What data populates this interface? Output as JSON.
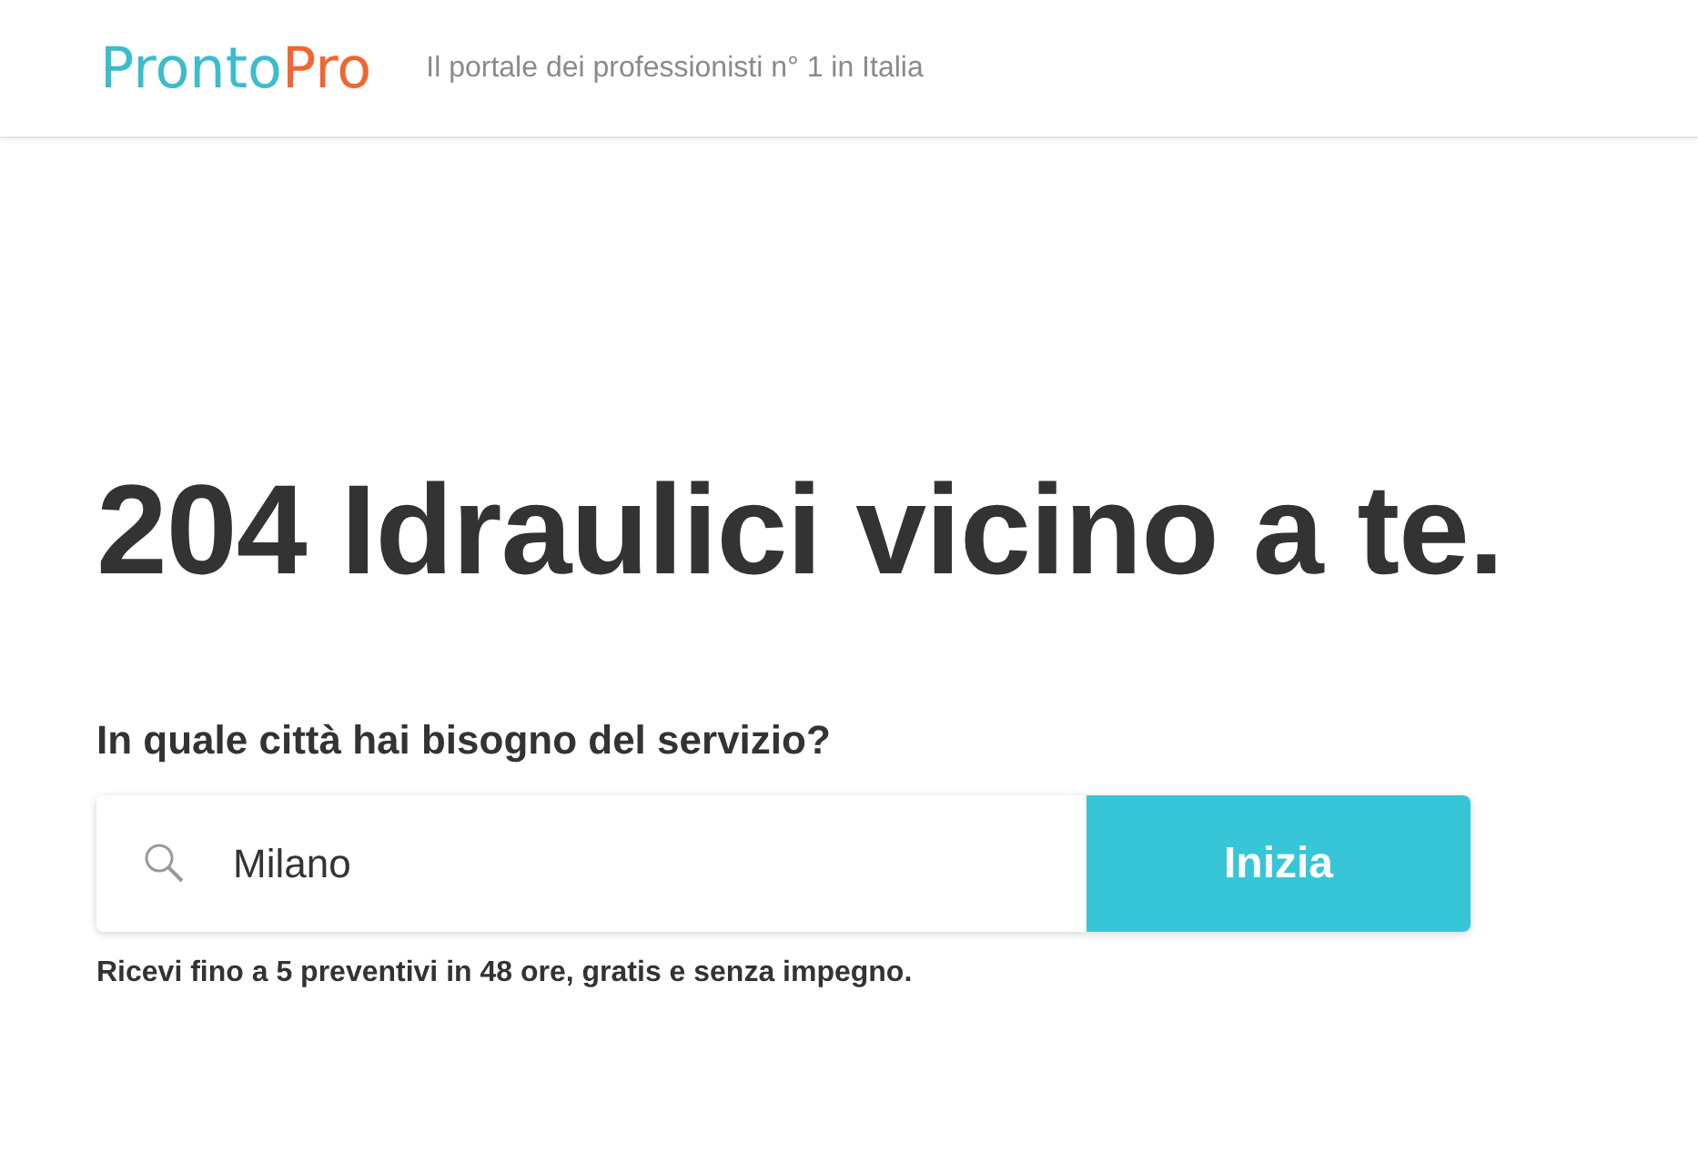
{
  "header": {
    "logo": {
      "first": "Pronto",
      "second": "Pro"
    },
    "tagline": "Il portale dei professionisti n° 1 in Italia"
  },
  "hero": {
    "headline": "204 Idraulici vicino a te.",
    "question": "In quale città hai bisogno del servizio?",
    "search": {
      "value": "Milano"
    },
    "button": "Inizia",
    "note": "Ricevi fino a 5 preventivi in 48 ore, gratis e senza impegno."
  }
}
